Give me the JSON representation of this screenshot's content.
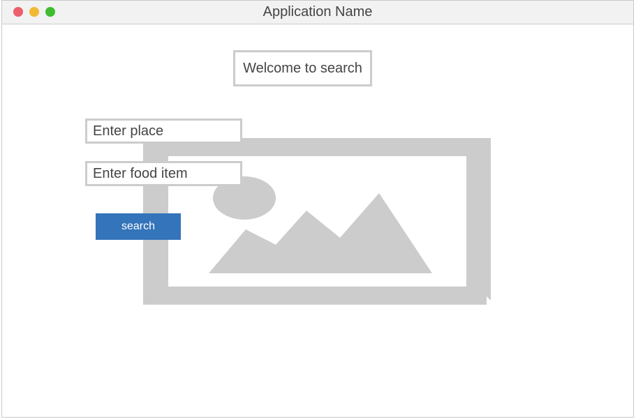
{
  "window": {
    "title": "Application Name"
  },
  "main": {
    "welcome_text": "Welcome to search",
    "place_placeholder": "Enter place",
    "food_placeholder": "Enter food item",
    "search_label": "search",
    "image_icon": "image-placeholder-icon"
  },
  "colors": {
    "accent": "#3474ba",
    "placeholder_gray": "#cccccc",
    "close": "#ec5f6b",
    "minimize": "#f1b934",
    "maximize": "#3ebd2f"
  }
}
